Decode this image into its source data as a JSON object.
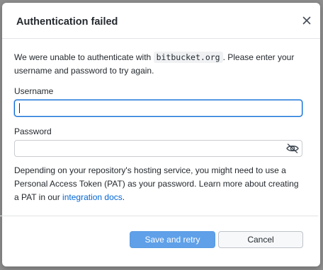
{
  "dialog": {
    "title": "Authentication failed",
    "close_icon": "close-icon"
  },
  "intro": {
    "before_host": "We were unable to authenticate with ",
    "host": "bitbucket.org",
    "after_host": ". Please enter your username and password to try again."
  },
  "username": {
    "label": "Username",
    "value": "",
    "placeholder": ""
  },
  "password": {
    "label": "Password",
    "value": "",
    "placeholder": "",
    "toggle_icon": "eye-off-icon"
  },
  "help": {
    "text": "Depending on your repository's hosting service, you might need to use a Personal Access Token (PAT) as your password. Learn more about creating a PAT in our ",
    "link_text": "integration docs",
    "after_link": "."
  },
  "buttons": {
    "save_label": "Save and retry",
    "cancel_label": "Cancel"
  },
  "colors": {
    "accent": "#0366d6",
    "primary_button": "#5fa0e8",
    "backdrop": "#8d8d8d"
  }
}
